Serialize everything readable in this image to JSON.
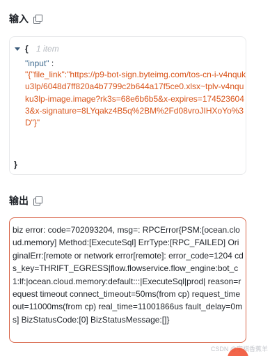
{
  "input_section": {
    "title": "输入",
    "json_open": "{",
    "item_count": "1 item",
    "key": "\"input\"",
    "colon": ":",
    "value": "\"{\"file_link\":\"https://p9-bot-sign.byteimg.com/tos-cn-i-v4nquku3lp/6048d7ff820a4b7799c2b644a17f5ce0.xlsx~tplv-v4nquku3lp-image.image?rk3s=68e6b6b5&x-expires=1745236043&x-signature=8LYqakz4B5q%2BM%2Fd08vroJIHXoYo%3D\"}\"",
    "json_close": "}"
  },
  "output_section": {
    "title": "输出",
    "text": "biz error: code=702093204, msg=: RPCError{PSM:[ocean.cloud.memory] Method:[ExecuteSql] ErrType:[RPC_FAILED] OriginalErr:[remote or network error[remote]: error_code=1204 cds_key=THRIFT_EGRESS|flow.flowservice.flow_engine:bot_c1:lf:|ocean.cloud.memory:default:::|ExecuteSql|prod| reason=request timeout connect_timeout=50ms(from cp) request_timeout=11000ms(from cp) real_time=11001866us fault_delay=0ms] BizStatusCode:[0] BizStatusMessage:[]}"
  },
  "watermark": "CSDN @宇祺香蕉羊",
  "colors": {
    "output_border": "#d8664a",
    "json_value": "#d9541a",
    "json_key": "#3f6b8f"
  },
  "icons": [
    "copy-icon",
    "caret-down-icon"
  ]
}
